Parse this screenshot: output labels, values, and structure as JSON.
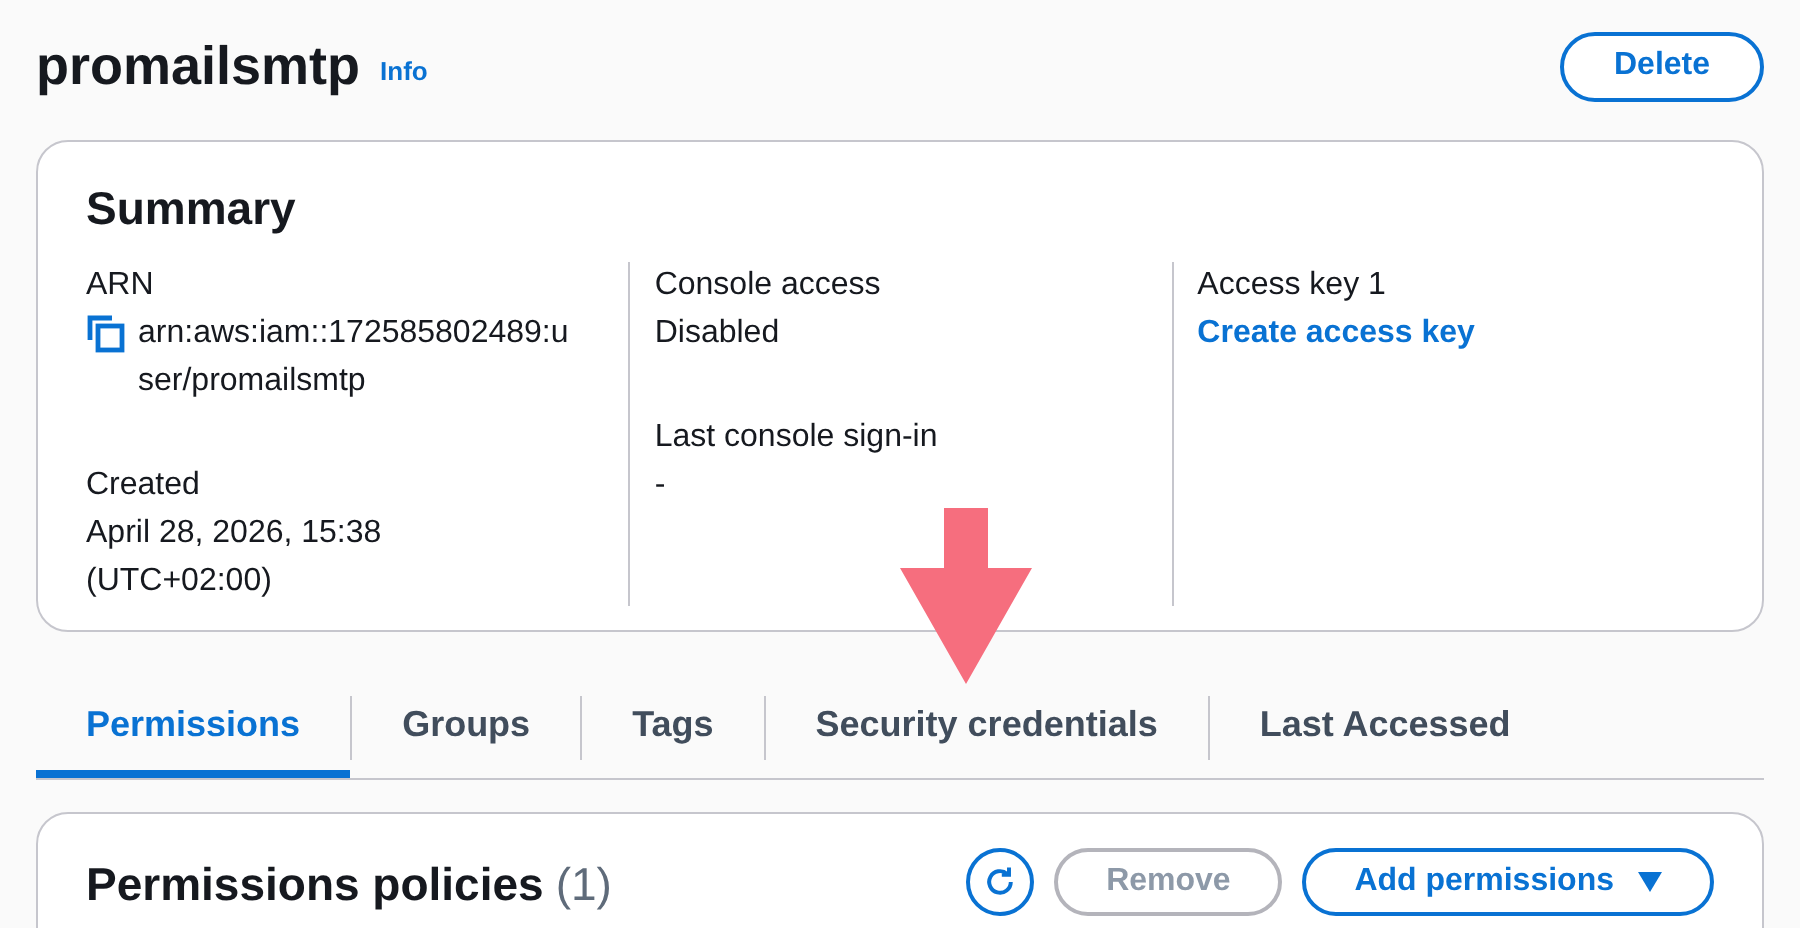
{
  "header": {
    "title": "promailsmtp",
    "info_link": "Info",
    "delete_button": "Delete"
  },
  "summary": {
    "title": "Summary",
    "columns": [
      {
        "fields": [
          {
            "kind": "copyable",
            "label": "ARN",
            "value": "arn:aws:iam::172585802489:user/promailsmtp"
          },
          {
            "kind": "text",
            "label": "Created",
            "value": "April 28, 2026, 15:38 (UTC+02:00)"
          }
        ]
      },
      {
        "fields": [
          {
            "kind": "text",
            "label": "Console access",
            "value": "Disabled"
          },
          {
            "kind": "text",
            "label": "Last console sign-in",
            "value": "-"
          }
        ]
      },
      {
        "fields": [
          {
            "kind": "link",
            "label": "Access key 1",
            "value": "Create access key"
          }
        ]
      }
    ]
  },
  "tabs": [
    {
      "label": "Permissions",
      "selected": true
    },
    {
      "label": "Groups",
      "selected": false
    },
    {
      "label": "Tags",
      "selected": false
    },
    {
      "label": "Security credentials",
      "selected": false
    },
    {
      "label": "Last Accessed",
      "selected": false
    }
  ],
  "permissions_policies": {
    "title": "Permissions policies",
    "count": "(1)",
    "remove_button": {
      "label": "Remove",
      "disabled": true
    },
    "add_button": "Add permissions"
  }
}
